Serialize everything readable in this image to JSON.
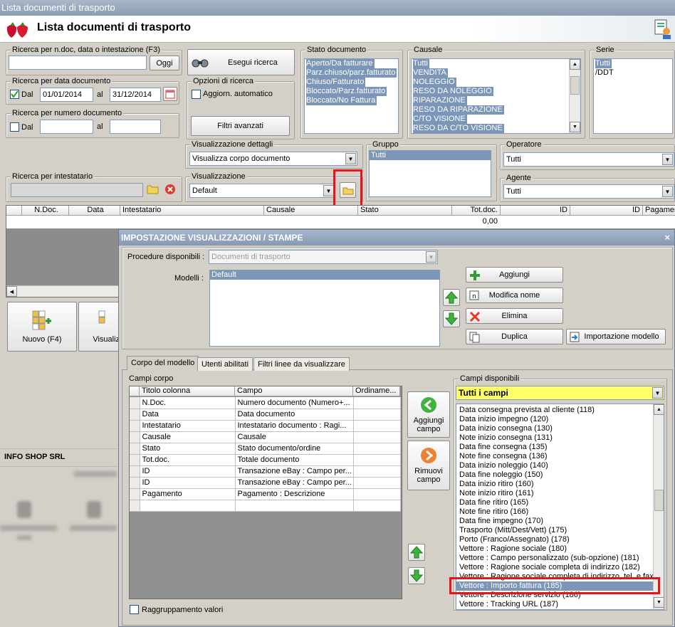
{
  "window": {
    "title": "Lista documenti di trasporto"
  },
  "header": {
    "title": "Lista documenti di trasporto"
  },
  "search": {
    "text_group": "Ricerca per n.doc, data o intestazione (F3)",
    "today_btn": "Oggi",
    "run_btn": "Esegui ricerca",
    "date_group": "Ricerca per data documento",
    "dal": "Dal",
    "date_from": "01/01/2014",
    "al": "al",
    "date_to": "31/12/2014",
    "number_group": "Ricerca per numero documento",
    "dal2": "Dal",
    "al2": "al",
    "holder_group": "Ricerca per intestatario",
    "options_group": "Opzioni di ricerca",
    "auto_update": "Aggiorn. automatico",
    "advanced_btn": "Filtri avanzati"
  },
  "stato": {
    "label": "Stato documento",
    "items": [
      "Aperto/Da fatturare",
      "Parz.chiuso/parz.fatturato",
      "Chiuso/Fatturato",
      "Bloccato/Parz.fatturato",
      "Bloccato/No Fattura"
    ]
  },
  "causale": {
    "label": "Causale",
    "items": [
      "Tutti",
      "VENDITA",
      "NOLEGGIO",
      "RESO DA NOLEGGIO",
      "RIPARAZIONE",
      "RESO DA RIPARAZIONE",
      "C/TO VISIONE",
      "RESO DA C/TO VISIONE"
    ]
  },
  "serie": {
    "label": "Serie",
    "items": [
      "Tutti",
      "/DDT"
    ]
  },
  "vis_dettagli": {
    "label": "Visualizzazione dettagli",
    "value": "Visualizza corpo documento"
  },
  "visualizzazione": {
    "label": "Visualizzazione",
    "value": "Default"
  },
  "gruppo": {
    "label": "Gruppo",
    "items": [
      "Tutti"
    ]
  },
  "operatore": {
    "label": "Operatore",
    "value": "Tutti"
  },
  "agente": {
    "label": "Agente",
    "value": "Tutti"
  },
  "grid": {
    "columns": [
      "N.Doc.",
      "Data",
      "Intestatario",
      "Causale",
      "Stato",
      "Tot.doc.",
      "ID",
      "ID",
      "Pagamen"
    ],
    "total": "0,00"
  },
  "actions": {
    "new_btn": "Nuovo (F4)",
    "view_btn": "Visualizza"
  },
  "company": "INFO SHOP SRL",
  "dialog": {
    "title": "IMPOSTAZIONE VISUALIZZAZIONI / STAMPE",
    "close": "×",
    "procedure_label": "Procedure disponibili :",
    "procedure_value": "Documenti di trasporto",
    "models_label": "Modelli :",
    "models": [
      "Default"
    ],
    "add_btn": "Aggiungi",
    "rename_btn": "Modifica nome",
    "delete_btn": "Elimina",
    "duplicate_btn": "Duplica",
    "import_btn": "Importazione modello",
    "tabs": [
      "Corpo del modello",
      "Utenti abilitati",
      "Filtri linee da visualizzare"
    ],
    "fields_label": "Campi corpo",
    "table_headers": [
      "Titolo colonna",
      "Campo",
      "Ordiname..."
    ],
    "rows": [
      [
        "N.Doc.",
        "Numero documento (Numero+..."
      ],
      [
        "Data",
        "Data documento"
      ],
      [
        "Intestatario",
        "Intestatario documento : Ragi..."
      ],
      [
        "Causale",
        "Causale"
      ],
      [
        "Stato",
        "Stato documento/ordine"
      ],
      [
        "Tot.doc.",
        "Totale documento"
      ],
      [
        "ID",
        "Transazione eBay : Campo per..."
      ],
      [
        "ID",
        "Transazione eBay : Campo per..."
      ],
      [
        "Pagamento",
        "Pagamento : Descrizione"
      ]
    ],
    "add_field": "Aggiungi campo",
    "remove_field": "Rimuovi campo",
    "available_label": "Campi disponibili",
    "available_filter": "Tutti i campi",
    "available": [
      "Data consegna prevista al cliente (118)",
      "Data inizio impegno (120)",
      "Data inizio consegna (130)",
      "Note inizio consegna (131)",
      "Data fine consegna (135)",
      "Note fine consegna (136)",
      "Data inizio noleggio (140)",
      "Data fine noleggio (150)",
      "Data inizio ritiro (160)",
      "Note inizio ritiro (161)",
      "Data fine ritiro (165)",
      "Note fine ritiro (166)",
      "Data fine impegno (170)",
      "Trasporto (Mitt/Dest/Vett) (175)",
      "Porto (Franco/Assegnato) (178)",
      "Vettore : Ragione sociale (180)",
      "Vettore : Campo personalizzato (sub-opzione) (181)",
      "Vettore : Ragione sociale completa di indirizzo (182)",
      "Vettore : Ragione sociale completa di indirizzo, tel. e fax",
      "Vettore : Importo fattura (185)",
      "Vettore : Descrizione servizio (186)",
      "Vettore : Tracking URL (187)"
    ],
    "grouping": "Raggruppamento valori"
  },
  "colors": {
    "selection": "#7c96b8",
    "highlight": "#e8141b",
    "title": "#8c9db4"
  }
}
